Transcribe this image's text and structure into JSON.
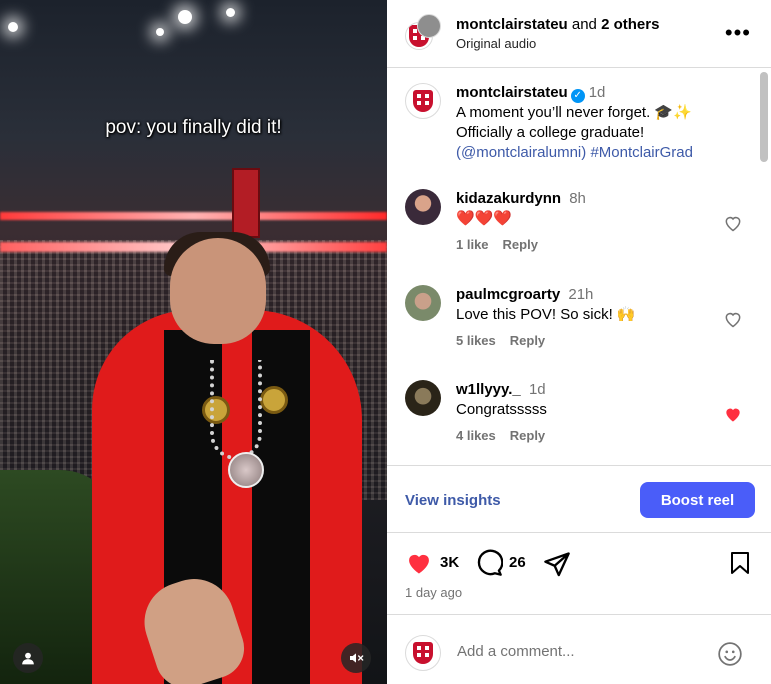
{
  "video": {
    "overlay_text": "pov: you finally did it!",
    "profile_icon": "user-icon",
    "mute_icon": "speaker-muted-icon"
  },
  "header": {
    "account": "montclairstateu",
    "and_text": "and",
    "others": "2 others",
    "subtitle": "Original audio",
    "more_icon": "more-horizontal-icon"
  },
  "caption": {
    "username": "montclairstateu",
    "time": "1d",
    "line1": "A moment you’ll never forget. 🎓✨",
    "line2": "Officially a college graduate!",
    "paren_open": "(",
    "mention": "@montclairalumni",
    "paren_close": ")",
    "hashtag": "#MontclairGrad"
  },
  "comments": [
    {
      "username": "kidazakurdynn",
      "time": "8h",
      "text": "❤️❤️❤️",
      "likes": "1 like",
      "reply": "Reply",
      "liked": false,
      "avatar_color": "#3a2a3a"
    },
    {
      "username": "paulmcgroarty",
      "time": "21h",
      "text": "Love this POV! So sick! 🙌",
      "likes": "5 likes",
      "reply": "Reply",
      "liked": false,
      "avatar_color": "#7a8a6a"
    },
    {
      "username": "w1llyyy._",
      "time": "1d",
      "text": "Congratsssss",
      "likes": "4 likes",
      "reply": "Reply",
      "liked": true,
      "avatar_color": "#5a4a2a"
    }
  ],
  "insights": {
    "view_label": "View insights",
    "boost_label": "Boost reel",
    "accent": "#4a5df9"
  },
  "actions": {
    "likes": "3K",
    "comments": "26",
    "posted": "1 day ago",
    "like_color": "#ff3040"
  },
  "add_comment": {
    "placeholder": "Add a comment..."
  }
}
